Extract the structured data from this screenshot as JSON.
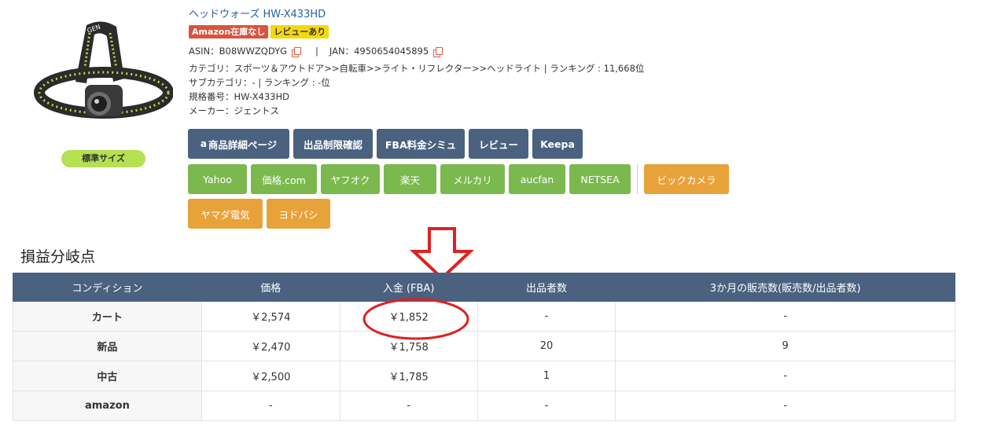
{
  "product": {
    "title": "ヘッドウォーズ HW-X433HD",
    "badges": [
      "Amazon在庫なし",
      "レビューあり"
    ],
    "asin_label": "ASIN：B08WWZQDYG",
    "jan_label": "JAN：4950654045895",
    "separator": "|",
    "category": "カテゴリ：スポーツ＆アウトドア>>自転車>>ライト・リフレクター>>ヘッドライト | ランキング : 11,668位",
    "subcategory": "サブカテゴリ：- | ランキング : -位",
    "model_number": "規格番号：HW-X433HD",
    "maker": "メーカー：ジェントス",
    "size_badge": "標準サイズ",
    "image_brand": "GEN"
  },
  "buttons": {
    "row1": [
      "商品詳細ページ",
      "出品制限確認",
      "FBA料金シミュ",
      "レビュー",
      "Keepa"
    ],
    "row2_green": [
      "Yahoo",
      "価格.com",
      "ヤフオク",
      "楽天",
      "メルカリ",
      "aucfan",
      "NETSEA"
    ],
    "row2_orange": [
      "ビックカメラ"
    ],
    "row3_orange": [
      "ヤマダ電気",
      "ヨドバシ"
    ],
    "amazon_glyph": "a"
  },
  "section": {
    "title": "損益分岐点"
  },
  "table": {
    "headers": [
      "コンディション",
      "価格",
      "入金 (FBA)",
      "出品者数",
      "3か月の販売数(販売数/出品者数)"
    ],
    "rows": [
      [
        "カート",
        "￥2,574",
        "￥1,852",
        "-",
        "-"
      ],
      [
        "新品",
        "￥2,470",
        "￥1,758",
        "20",
        "9"
      ],
      [
        "中古",
        "￥2,500",
        "￥1,785",
        "1",
        "-"
      ],
      [
        "amazon",
        "-",
        "-",
        "-",
        "-"
      ]
    ]
  },
  "colors": {
    "navy": "#4a6280",
    "green": "#7bb94f",
    "orange": "#e8a23a",
    "annotation_red": "#e02020",
    "title_blue": "#2a5fa0"
  }
}
